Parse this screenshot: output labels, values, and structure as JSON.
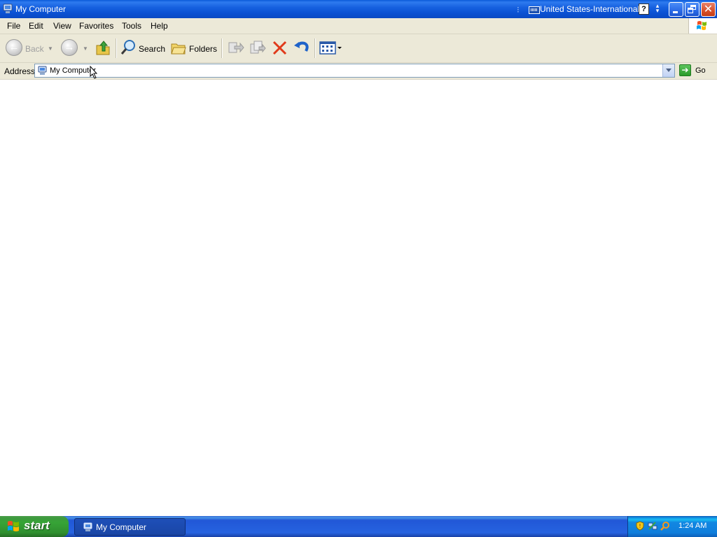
{
  "window": {
    "title": "My Computer"
  },
  "language_bar": {
    "language": "United States-International",
    "help_symbol": "?"
  },
  "menu": {
    "items": [
      "File",
      "Edit",
      "View",
      "Favorites",
      "Tools",
      "Help"
    ]
  },
  "toolbar": {
    "back_label": "Back",
    "search_label": "Search",
    "folders_label": "Folders"
  },
  "address": {
    "label": "Address",
    "value": "My Computer",
    "go_label": "Go"
  },
  "taskbar": {
    "start_label": "start",
    "task_label": "My Computer",
    "clock": "1:24 AM"
  },
  "colors": {
    "titlebar": "#0a5ad8",
    "close_button": "#d8502a",
    "start_button": "#37a437",
    "taskbar": "#2663e0",
    "tray": "#0f7edc"
  },
  "icons": [
    "computer-icon",
    "keyboard-icon",
    "help-icon",
    "minimize-icon",
    "restore-icon",
    "close-icon",
    "windows-logo-icon",
    "back-icon",
    "forward-icon",
    "up-folder-icon",
    "search-icon",
    "folders-icon",
    "move-to-icon",
    "copy-to-icon",
    "delete-icon",
    "undo-icon",
    "views-icon",
    "go-icon",
    "shield-icon",
    "network-icon"
  ]
}
